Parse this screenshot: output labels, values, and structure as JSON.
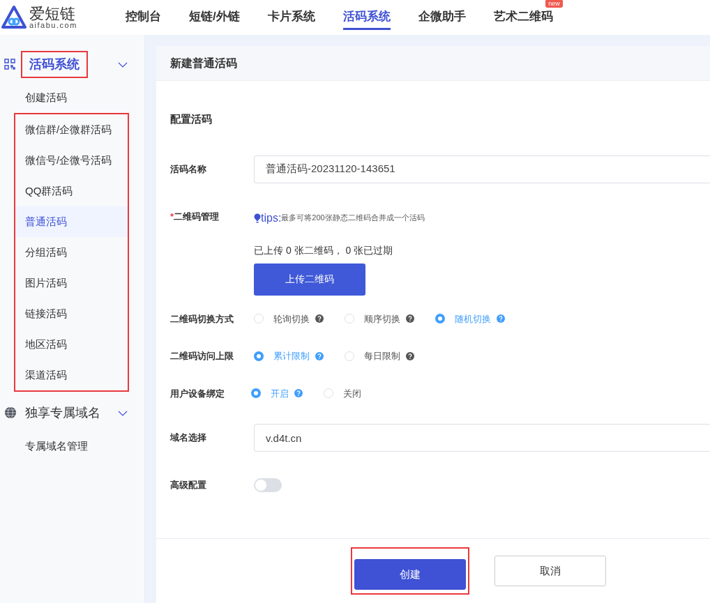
{
  "logo": {
    "name": "爱短链",
    "domain": "aifabu.com"
  },
  "top_nav": [
    {
      "label": "控制台",
      "selected": false
    },
    {
      "label": "短链/外链",
      "selected": false
    },
    {
      "label": "卡片系统",
      "selected": false
    },
    {
      "label": "活码系统",
      "selected": true
    },
    {
      "label": "企微助手",
      "selected": false
    },
    {
      "label": "艺术二维码",
      "selected": false,
      "badge": "new"
    }
  ],
  "sidebar": {
    "sections": [
      {
        "label": "活码系统",
        "expanded": true,
        "highlighted": true,
        "items": [
          {
            "label": "创建活码",
            "selected": false,
            "highlighted": false
          },
          {
            "label": "微信群/企微群活码",
            "selected": false,
            "highlighted": true
          },
          {
            "label": "微信号/企微号活码",
            "selected": false,
            "highlighted": true
          },
          {
            "label": "QQ群活码",
            "selected": false,
            "highlighted": true
          },
          {
            "label": "普通活码",
            "selected": true,
            "highlighted": true
          },
          {
            "label": "分组活码",
            "selected": false,
            "highlighted": true
          },
          {
            "label": "图片活码",
            "selected": false,
            "highlighted": true
          },
          {
            "label": "链接活码",
            "selected": false,
            "highlighted": true
          },
          {
            "label": "地区活码",
            "selected": false,
            "highlighted": true
          },
          {
            "label": "渠道活码",
            "selected": false,
            "highlighted": true
          }
        ]
      },
      {
        "label": "独享专属域名",
        "expanded": true,
        "highlighted": false,
        "items": [
          {
            "label": "专属域名管理",
            "selected": false,
            "highlighted": false
          }
        ]
      }
    ]
  },
  "panel": {
    "title": "新建普通活码",
    "section_title": "配置活码",
    "fields": [
      {
        "kind": "text",
        "label": "活码名称",
        "value": "普通活码-20231120-143651"
      },
      {
        "kind": "upload",
        "label": "二维码管理",
        "required_mark": "*",
        "tip_label": "tips:",
        "tip": "最多可将200张静态二维码合并成一个活码",
        "status": "已上传 0 张二维码， 0 张已过期",
        "button": "上传二维码"
      },
      {
        "kind": "radio",
        "label": "二维码切换方式",
        "options": [
          {
            "label": "轮询切换",
            "selected": false
          },
          {
            "label": "顺序切换",
            "selected": false
          },
          {
            "label": "随机切换",
            "selected": true
          }
        ]
      },
      {
        "kind": "radio",
        "label": "二维码访问上限",
        "options": [
          {
            "label": "累计限制",
            "selected": true
          },
          {
            "label": "每日限制",
            "selected": false
          }
        ]
      },
      {
        "kind": "radio",
        "label": "用户设备绑定",
        "options": [
          {
            "label": "开启",
            "selected": true,
            "help": true
          },
          {
            "label": "关闭",
            "selected": false,
            "help": false
          }
        ]
      },
      {
        "kind": "text",
        "label": "域名选择",
        "value": "v.d4t.cn"
      },
      {
        "kind": "switch",
        "label": "高级配置",
        "on": false
      }
    ],
    "buttons": [
      {
        "label": "创建",
        "primary": true,
        "highlighted": true
      },
      {
        "label": "取消",
        "primary": false,
        "highlighted": false
      }
    ]
  }
}
